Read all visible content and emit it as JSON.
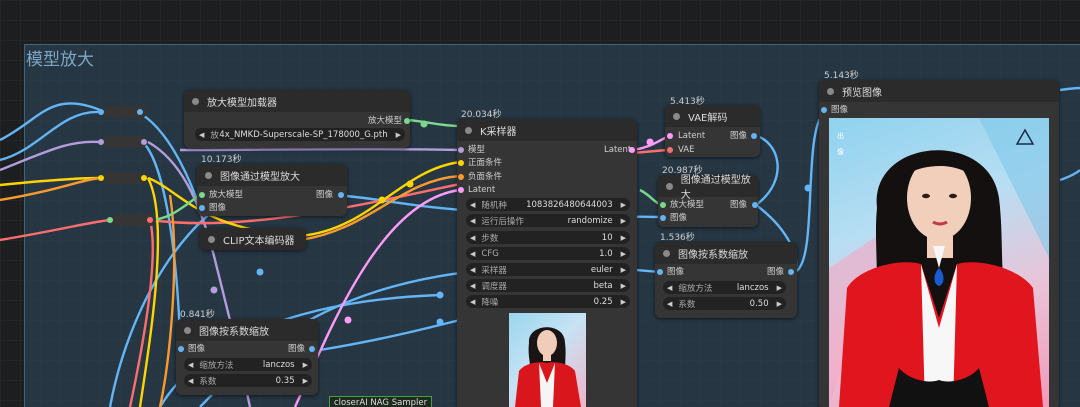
{
  "group": {
    "title": "模型放大"
  },
  "nodes": {
    "upscale_loader": {
      "title": "放大模型加载器",
      "out": "放大模型",
      "widget_prefix": "放",
      "widget_value": "4x_NMKD-Superscale-SP_178000_G.pth"
    },
    "image_upscale_model_1": {
      "time": "10.173秒",
      "title": "图像通过模型放大",
      "in1": "放大模型",
      "in2": "图像",
      "out": "图像"
    },
    "clip_text": {
      "title": "CLIP文本编码器"
    },
    "image_scale_1": {
      "time": "0.841秒",
      "title": "图像按系数缩放",
      "in": "图像",
      "out": "图像",
      "w1_label": "缩放方法",
      "w1_value": "lanczos",
      "w2_label": "系数",
      "w2_value": "0.35"
    },
    "ksampler": {
      "time": "20.034秒",
      "title": "K采样器",
      "in1": "模型",
      "in2": "正面条件",
      "in3": "负面条件",
      "in4": "Latent",
      "out": "Latent",
      "widgets": [
        {
          "label": "随机种",
          "value": "1083826480644003"
        },
        {
          "label": "运行后操作",
          "value": "randomize"
        },
        {
          "label": "步数",
          "value": "10"
        },
        {
          "label": "CFG",
          "value": "1.0"
        },
        {
          "label": "采样器",
          "value": "euler"
        },
        {
          "label": "调度器",
          "value": "beta"
        },
        {
          "label": "降噪",
          "value": "0.25"
        }
      ]
    },
    "vae_decode": {
      "time": "5.413秒",
      "title": "VAE解码",
      "in1": "Latent",
      "in2": "VAE",
      "out": "图像"
    },
    "image_upscale_model_2": {
      "time": "20.987秒",
      "title": "图像通过模型放大",
      "in1": "放大模型",
      "in2": "图像",
      "out": "图像"
    },
    "image_scale_2": {
      "time": "1.536秒",
      "title": "图像按系数缩放",
      "in": "图像",
      "out": "图像",
      "w1_label": "缩放方法",
      "w1_value": "lanczos",
      "w2_label": "系数",
      "w2_value": "0.50"
    },
    "preview": {
      "time": "5.143秒",
      "title": "预览图像",
      "in": "图像"
    }
  },
  "bottom_tag": "closerAI NAG Sampler",
  "colors": {
    "model": "#b39ddb",
    "image": "#64b5f6",
    "latent": "#ff9cf9",
    "vae": "#ff6e6e",
    "cond_pos": "#ffd500",
    "cond_neg": "#fa9a2f",
    "upscale": "#7bd98d"
  }
}
